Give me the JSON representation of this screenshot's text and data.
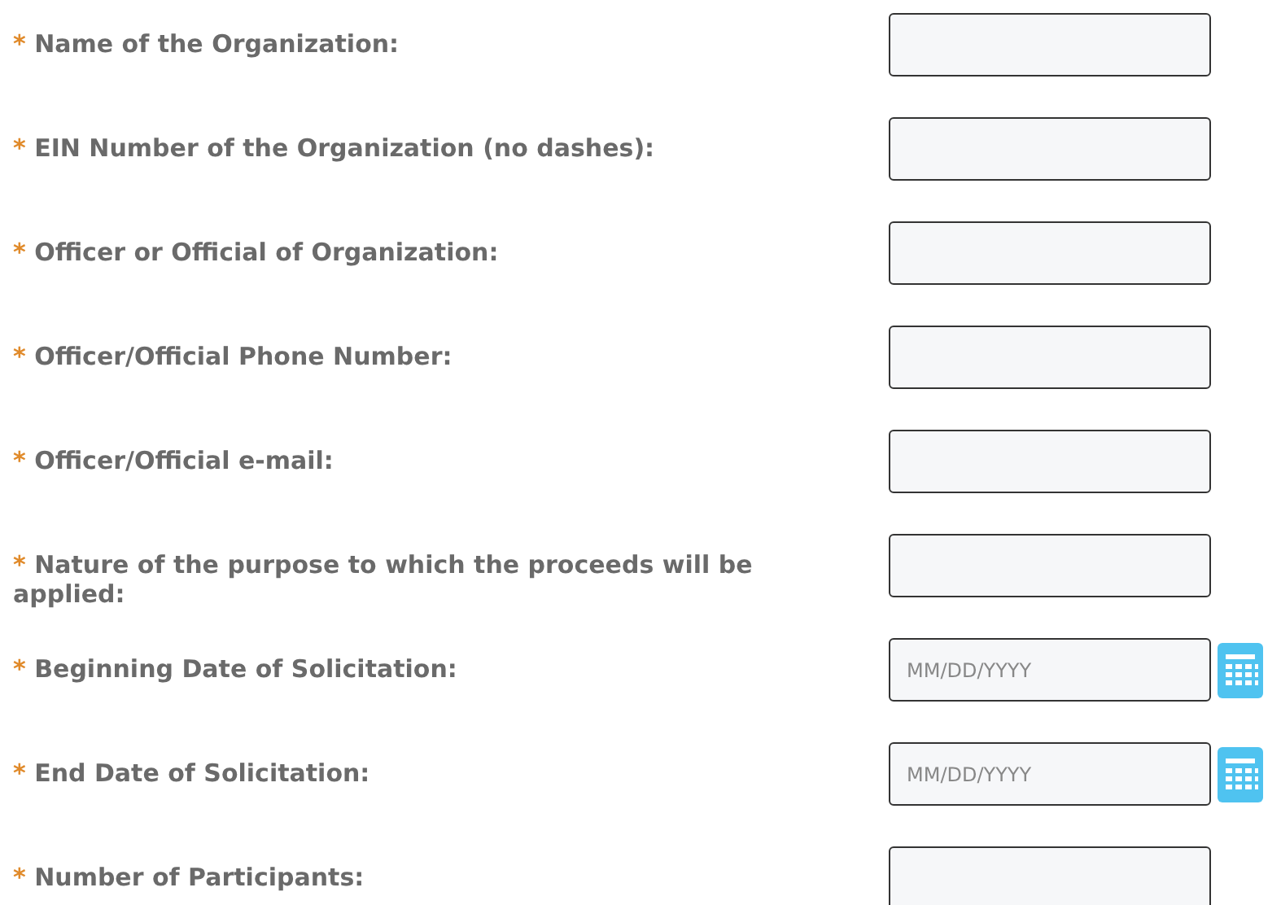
{
  "fields": [
    {
      "required_mark": "*",
      "label": "Name of the Organization:",
      "kind": "text"
    },
    {
      "required_mark": "*",
      "label": "EIN Number of the Organization (no dashes):",
      "kind": "text"
    },
    {
      "required_mark": "*",
      "label": "Officer or Official of Organization:",
      "kind": "text"
    },
    {
      "required_mark": "*",
      "label": "Officer/Official Phone Number:",
      "kind": "text"
    },
    {
      "required_mark": "*",
      "label": "Officer/Official e-mail:",
      "kind": "text"
    },
    {
      "required_mark": "*",
      "label": "Nature of the purpose to which the proceeds will be applied:",
      "kind": "text"
    },
    {
      "required_mark": "*",
      "label": "Beginning Date of Solicitation:",
      "kind": "date",
      "placeholder": "MM/DD/YYYY"
    },
    {
      "required_mark": "*",
      "label": "End Date of Solicitation:",
      "kind": "date",
      "placeholder": "MM/DD/YYYY"
    },
    {
      "required_mark": "*",
      "label": "Number of Participants:",
      "kind": "text"
    }
  ]
}
